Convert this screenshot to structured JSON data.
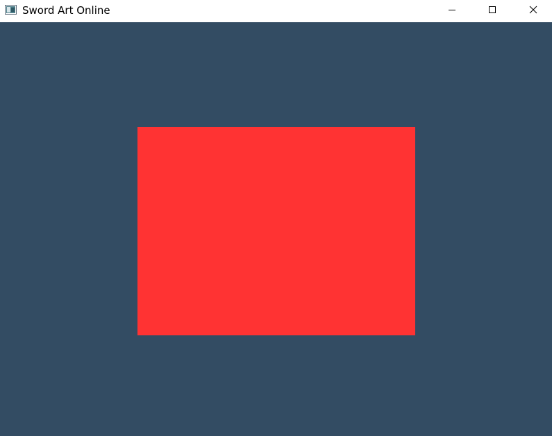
{
  "window": {
    "title": "Sword Art Online",
    "app_icon": "window-app-icon",
    "controls": {
      "minimize_icon": "minimize-icon",
      "maximize_icon": "maximize-icon",
      "close_icon": "close-icon"
    }
  },
  "scene": {
    "clear_color": "#334c63",
    "quad_color": "#ff3333"
  }
}
